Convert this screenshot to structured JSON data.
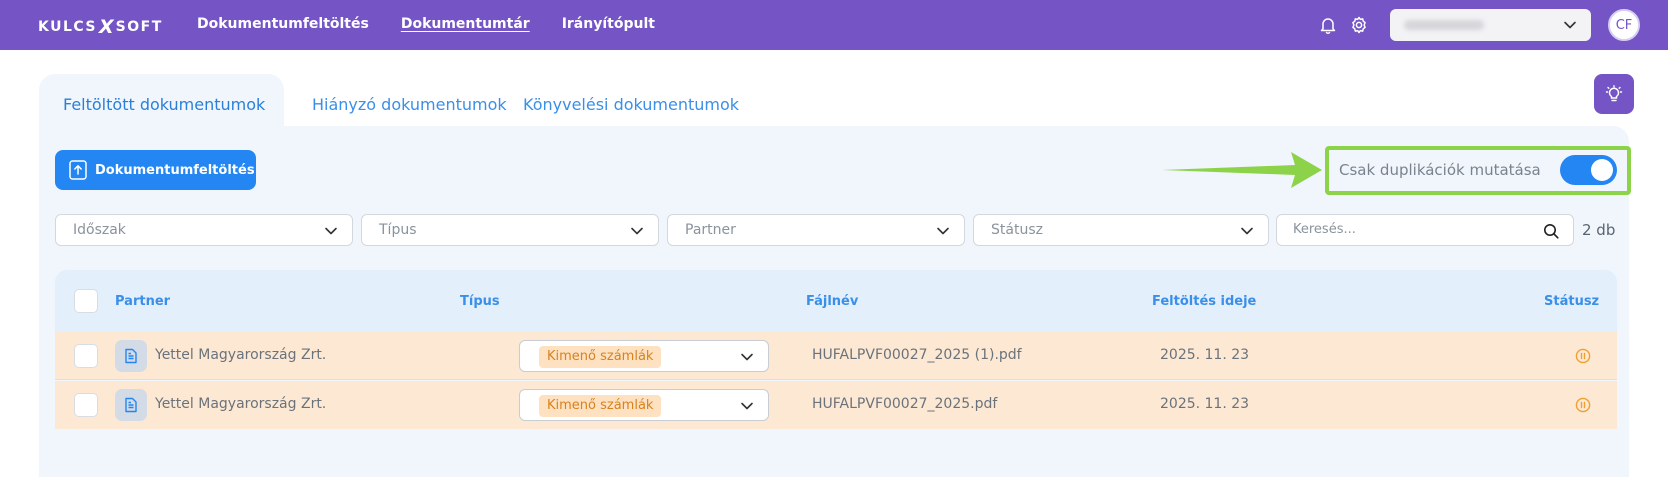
{
  "header": {
    "logo_left": "KULCS",
    "logo_x": "X",
    "logo_right": "SOFT",
    "nav": [
      {
        "label": "Dokumentumfeltöltés"
      },
      {
        "label": "Dokumentumtár"
      },
      {
        "label": "Irányítópult"
      }
    ],
    "avatar_initials": "CF",
    "icons": {
      "bell": "bell-icon",
      "gear": "gear-icon",
      "chevron": "chevron-down-icon"
    }
  },
  "tabs": [
    {
      "label": "Feltöltött dokumentumok"
    },
    {
      "label": "Hiányzó dokumentumok"
    },
    {
      "label": "Könyvelési dokumentumok"
    }
  ],
  "toolbar": {
    "upload_label": "Dokumentumfeltöltés",
    "duplicates_label": "Csak duplikációk mutatása",
    "duplicates_on": true
  },
  "filters": {
    "period": "Időszak",
    "type": "Típus",
    "partner": "Partner",
    "status": "Státusz",
    "search_placeholder": "Keresés...",
    "count": "2 db"
  },
  "table": {
    "columns": {
      "partner": "Partner",
      "type": "Típus",
      "filename": "Fájlnév",
      "upload_time": "Feltöltés ideje",
      "status": "Státusz"
    },
    "rows": [
      {
        "partner": "Yettel Magyarország Zrt.",
        "type": "Kimenő számlák",
        "filename": "HUFALPVF00027_2025 (1).pdf",
        "date": "2025. 11. 23"
      },
      {
        "partner": "Yettel Magyarország Zrt.",
        "type": "Kimenő számlák",
        "filename": "HUFALPVF00027_2025.pdf",
        "date": "2025. 11. 23"
      }
    ]
  },
  "colors": {
    "brand": "#7555c6",
    "primary": "#2386f2",
    "highlight": "#8cd34a",
    "row_bg": "#fde8d3",
    "badge_text": "#d8821e",
    "status_pending": "#f0a030"
  }
}
